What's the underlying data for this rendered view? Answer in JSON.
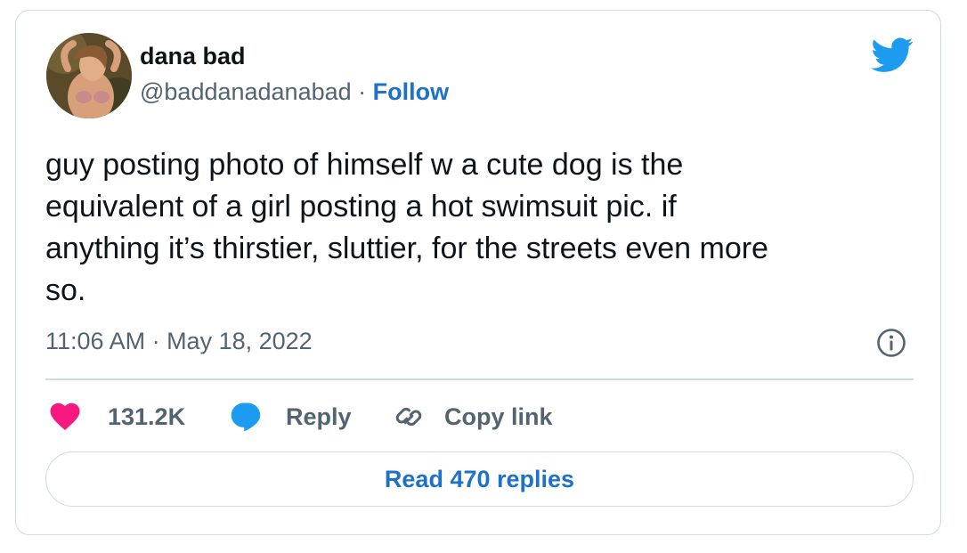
{
  "tweet": {
    "author": {
      "display_name": "dana bad",
      "handle": "@baddanadanabad",
      "separator": " · ",
      "follow_label": "Follow",
      "avatar_icon": "profile-avatar"
    },
    "brand_icon": "twitter-bird-icon",
    "text": "guy posting photo of himself w a cute dog is the\nequivalent of a girl posting a hot swimsuit pic. if\nanything it’s thirstier, sluttier, for the streets even more\nso.",
    "timestamp": "11:06 AM · May 18, 2022",
    "actions": {
      "like_count": "131.2K",
      "reply_label": "Reply",
      "copy_label": "Copy link"
    },
    "read_replies_label": "Read 470 replies",
    "colors": {
      "brand": "#1d9bf0",
      "link": "#1d72c8",
      "like": "#f91880",
      "muted": "#536471",
      "border": "#cfd9de"
    }
  }
}
